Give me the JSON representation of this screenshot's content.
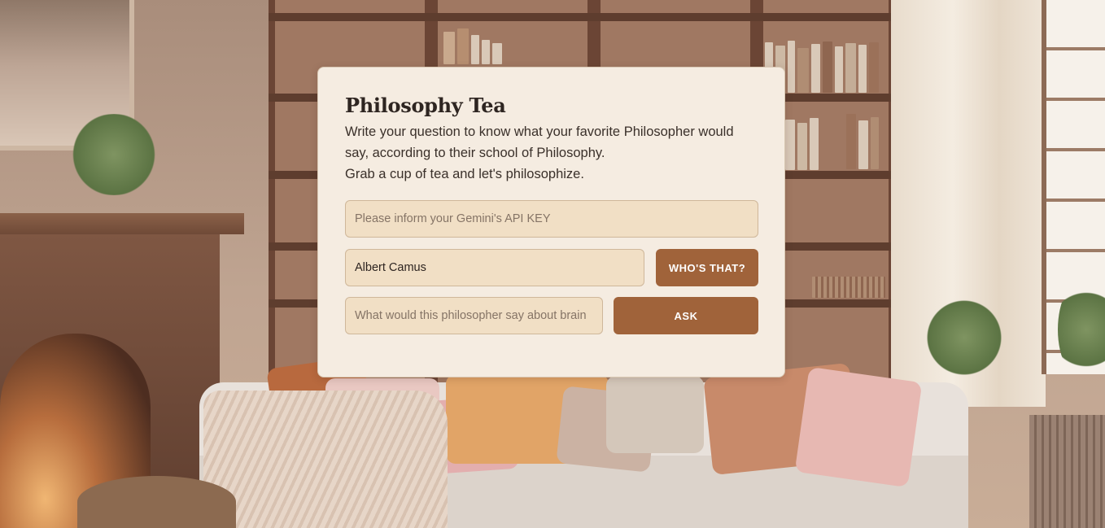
{
  "card": {
    "title": "Philosophy Tea",
    "description": "Write your question to know what your favorite Philosopher would say, according to their school of Philosophy.\nGrab a cup of tea and let's philosophize."
  },
  "api_key_input": {
    "value": "",
    "placeholder": "Please inform your Gemini's API KEY"
  },
  "philosopher_input": {
    "value": "Albert Camus",
    "placeholder": ""
  },
  "whos_that_button": {
    "label": "WHO'S THAT?"
  },
  "question_input": {
    "value": "",
    "placeholder": "What would this philosopher say about brain"
  },
  "ask_button": {
    "label": "ASK"
  },
  "theme": {
    "accent": "#a0633a",
    "card_background": "#f5ece1",
    "input_background": "#f1dfc5"
  }
}
